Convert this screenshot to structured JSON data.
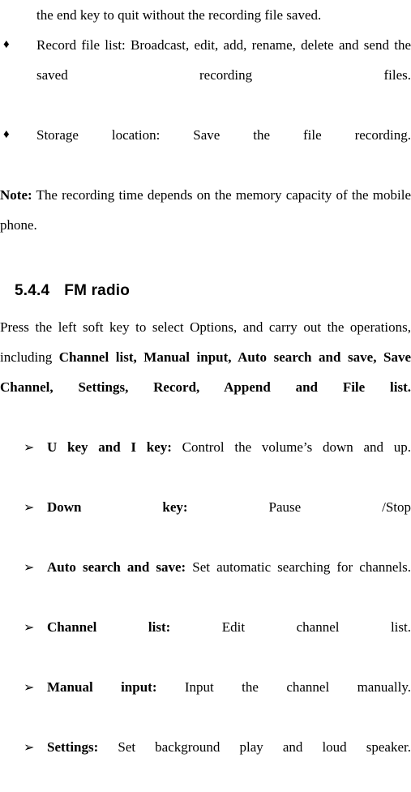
{
  "page": {
    "continuation_line": "the end key to quit without the recording file saved.",
    "diamond_bullets": [
      {
        "glyph": "♦",
        "icon": "diamond-bullet-icon",
        "text": "Record file list: Broadcast, edit, add, rename, delete and send the saved recording files."
      },
      {
        "glyph": "♦",
        "icon": "diamond-bullet-icon",
        "text": "Storage location: Save the file recording."
      }
    ],
    "note": {
      "lead": "Note:",
      "text": " The recording time depends on the memory capacity of the mobile phone."
    },
    "heading": {
      "number": "5.4.4",
      "title": "FM radio"
    },
    "intro_paragraph": {
      "part1": "Press the left soft key to select Options, and carry out the operations, including ",
      "part2_bold": "Channel list, Manual input, Auto search and save, Save Channel, Settings, Record, Append and File list."
    },
    "arrow_bullets": [
      {
        "glyph": "➢",
        "icon": "arrow-bullet-icon",
        "term": "U key and I key:",
        "description": " Control the volume’s down and up."
      },
      {
        "glyph": "➢",
        "icon": "arrow-bullet-icon",
        "term": "Down key:",
        "description": " Pause /Stop"
      },
      {
        "glyph": "➢",
        "icon": "arrow-bullet-icon",
        "term": "Auto search and save:",
        "description": " Set automatic searching for channels."
      },
      {
        "glyph": "➢",
        "icon": "arrow-bullet-icon",
        "term": "Channel list:",
        "description": " Edit channel list."
      },
      {
        "glyph": "➢",
        "icon": "arrow-bullet-icon",
        "term": "Manual input:",
        "description": " Input the channel manually."
      },
      {
        "glyph": "➢",
        "icon": "arrow-bullet-icon",
        "term": "Settings:",
        "description": " Set background play and loud speaker."
      }
    ]
  }
}
